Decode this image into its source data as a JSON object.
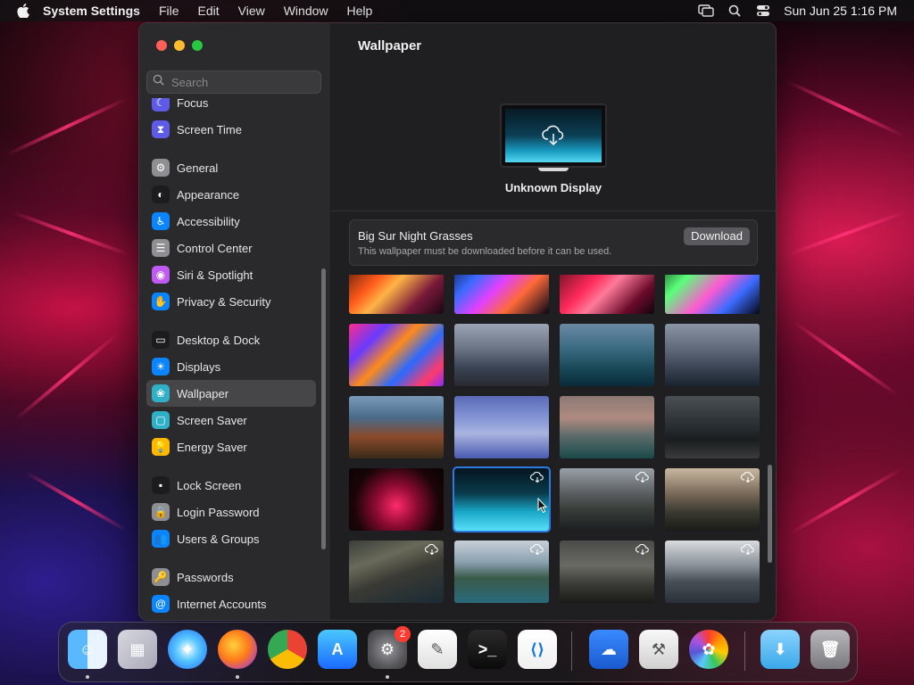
{
  "menubar": {
    "app_name": "System Settings",
    "menus": [
      "File",
      "Edit",
      "View",
      "Window",
      "Help"
    ],
    "clock": "Sun Jun 25  1:16 PM"
  },
  "sidebar": {
    "search_placeholder": "Search",
    "items": [
      {
        "label": "Focus",
        "icon": "moon-icon",
        "color": "#5e5ce6"
      },
      {
        "label": "Screen Time",
        "icon": "hourglass-icon",
        "color": "#5e5ce6"
      },
      {
        "label": "General",
        "icon": "gear-icon",
        "color": "#8e8e93"
      },
      {
        "label": "Appearance",
        "icon": "appearance-icon",
        "color": "#1c1c1e"
      },
      {
        "label": "Accessibility",
        "icon": "accessibility-icon",
        "color": "#0a84ff"
      },
      {
        "label": "Control Center",
        "icon": "control-center-icon",
        "color": "#8e8e93"
      },
      {
        "label": "Siri & Spotlight",
        "icon": "siri-icon",
        "color": "#bf5af2"
      },
      {
        "label": "Privacy & Security",
        "icon": "hand-icon",
        "color": "#0a84ff"
      },
      {
        "label": "Desktop & Dock",
        "icon": "dock-icon",
        "color": "#1c1c1e"
      },
      {
        "label": "Displays",
        "icon": "sun-icon",
        "color": "#0a84ff"
      },
      {
        "label": "Wallpaper",
        "icon": "wallpaper-icon",
        "color": "#30b0c7"
      },
      {
        "label": "Screen Saver",
        "icon": "screen-saver-icon",
        "color": "#30b0c7"
      },
      {
        "label": "Energy Saver",
        "icon": "battery-icon",
        "color": "#ffb800"
      },
      {
        "label": "Lock Screen",
        "icon": "lock-icon",
        "color": "#1c1c1e"
      },
      {
        "label": "Login Password",
        "icon": "padlock-icon",
        "color": "#8e8e93"
      },
      {
        "label": "Users & Groups",
        "icon": "users-icon",
        "color": "#0a84ff"
      },
      {
        "label": "Passwords",
        "icon": "key-icon",
        "color": "#8e8e93"
      },
      {
        "label": "Internet Accounts",
        "icon": "at-icon",
        "color": "#0a84ff"
      }
    ],
    "active": "Wallpaper"
  },
  "content": {
    "title": "Wallpaper",
    "display_name": "Unknown Display",
    "notice": {
      "title": "Big Sur Night Grasses",
      "subtitle": "This wallpaper must be downloaded before it can be used.",
      "button": "Download"
    },
    "thumbnails": [
      {
        "name": "macbook-pro-orange",
        "gradient": "linear-gradient(135deg,#2a0a05 0%,#ff5a1a 35%,#ffb347 50%,#7a1a3a 75%,#1a0510 100%)"
      },
      {
        "name": "macbook-pro-purple",
        "gradient": "linear-gradient(135deg,#050a2a 0%,#3a6bff 30%,#e040ff 50%,#ff6a3a 70%,#050515 100%)"
      },
      {
        "name": "macbook-pro-red",
        "gradient": "linear-gradient(135deg,#3a0510 0%,#ff2a5a 40%,#ff7a9a 55%,#6a0a2a 80%,#10050a 100%)"
      },
      {
        "name": "macbook-pro-green",
        "gradient": "linear-gradient(135deg,#0a2a10 0%,#5aff7a 30%,#ff5ad0 55%,#3a6bff 75%,#050510 100%)"
      },
      {
        "name": "memphis-pattern",
        "gradient": "linear-gradient(135deg,#ff2a8a 0%,#6a3aff 25%,#ff8a1a 45%,#2a6aff 65%,#ff3a6a 85%,#8a2aff 100%)"
      },
      {
        "name": "misty-mountains",
        "gradient": "linear-gradient(180deg,#9aa4b4 0%,#6a7484 40%,#3a4454 70%,#2a2a30 100%)"
      },
      {
        "name": "catalina-island",
        "gradient": "linear-gradient(180deg,#6a8aa4 0%,#3a6a80 40%,#1a4a5a 70%,#0a2a3a 100%)"
      },
      {
        "name": "rocks-in-sea",
        "gradient": "linear-gradient(180deg,#8a94a4 0%,#5a6474 45%,#3a4454 70%,#1a2430 100%)"
      },
      {
        "name": "coastal-cliffs",
        "gradient": "linear-gradient(180deg,#7a9ab8 0%,#4a6a8a 35%,#8a4a2a 65%,#3a2a1a 100%)"
      },
      {
        "name": "sea-stack-blue",
        "gradient": "linear-gradient(180deg,#5a6ab8 0%,#8a9ad8 40%,#aab4e0 60%,#4a5ab0 100%)"
      },
      {
        "name": "rocky-shore",
        "gradient": "linear-gradient(180deg,#8a7a74 0%,#b08a80 35%,#5a6a6a 65%,#1a4a4a 100%)"
      },
      {
        "name": "mountain-road",
        "gradient": "linear-gradient(180deg,#4a5054 0%,#2a3034 45%,#1a1e20 70%,#3a3a3a 100%)"
      },
      {
        "name": "night-grasses-red",
        "gradient": "radial-gradient(circle at 50% 60%,#ff2a6a 0%,#8a0a30 35%,#1a0508 70%,#0a0204 100%)"
      },
      {
        "name": "night-grasses-blue",
        "gradient": "linear-gradient(180deg,#051520 0%,#0a3a4a 40%,#1aa8c8 70%,#5ae0f8 100%)"
      },
      {
        "name": "cliffs-dusk",
        "gradient": "linear-gradient(180deg,#9aa0a8 0%,#5a5e60 40%,#3a3e3a 65%,#1a1e20 100%)"
      },
      {
        "name": "cliffs-sunset",
        "gradient": "linear-gradient(180deg,#c8b8a0 0%,#7a6a5a 40%,#3a3a30 70%,#1a1a18 100%)"
      },
      {
        "name": "striped-rocks",
        "gradient": "linear-gradient(160deg,#3a3e3a 0%,#6a6a5a 30%,#3a3a34 55%,#1a2a34 100%)"
      },
      {
        "name": "coast-green",
        "gradient": "linear-gradient(180deg,#c8d0d8 0%,#8aa0b0 35%,#3a5a4a 60%,#2a6a7a 100%)"
      },
      {
        "name": "calm-sea-dusk",
        "gradient": "linear-gradient(180deg,#4a4a48 0%,#6a6a64 40%,#3a3a36 70%,#1a1a18 100%)"
      },
      {
        "name": "island-clouds",
        "gradient": "linear-gradient(180deg,#d8dce0 0%,#8a9098 40%,#4a5058 65%,#2a3038 100%)"
      }
    ],
    "cloud_badge_indexes": [
      13,
      14,
      15,
      16,
      17,
      18,
      19
    ],
    "selected_index": 13
  },
  "dock": {
    "apps": [
      {
        "name": "Finder",
        "icon": "finder-icon",
        "running": true
      },
      {
        "name": "Launchpad",
        "icon": "launchpad-icon",
        "running": false
      },
      {
        "name": "Safari",
        "icon": "safari-icon",
        "running": false
      },
      {
        "name": "Firefox",
        "icon": "firefox-icon",
        "running": true
      },
      {
        "name": "Chrome",
        "icon": "chrome-icon",
        "running": false
      },
      {
        "name": "App Store",
        "icon": "app-store-icon",
        "running": false
      },
      {
        "name": "System Settings",
        "icon": "system-settings-icon",
        "running": true,
        "badge": "2"
      },
      {
        "name": "TextEdit",
        "icon": "textedit-icon",
        "running": false
      },
      {
        "name": "Terminal",
        "icon": "terminal-icon",
        "running": false
      },
      {
        "name": "VS Code",
        "icon": "vscode-icon",
        "running": false
      },
      {
        "name": "Weather",
        "icon": "weather-icon",
        "running": false
      },
      {
        "name": "Archive Utility",
        "icon": "archive-utility-icon",
        "running": false
      },
      {
        "name": "Photos",
        "icon": "photos-icon",
        "running": false
      },
      {
        "name": "Downloads",
        "icon": "downloads-folder-icon",
        "running": false
      },
      {
        "name": "Trash",
        "icon": "trash-icon",
        "running": false
      }
    ]
  }
}
